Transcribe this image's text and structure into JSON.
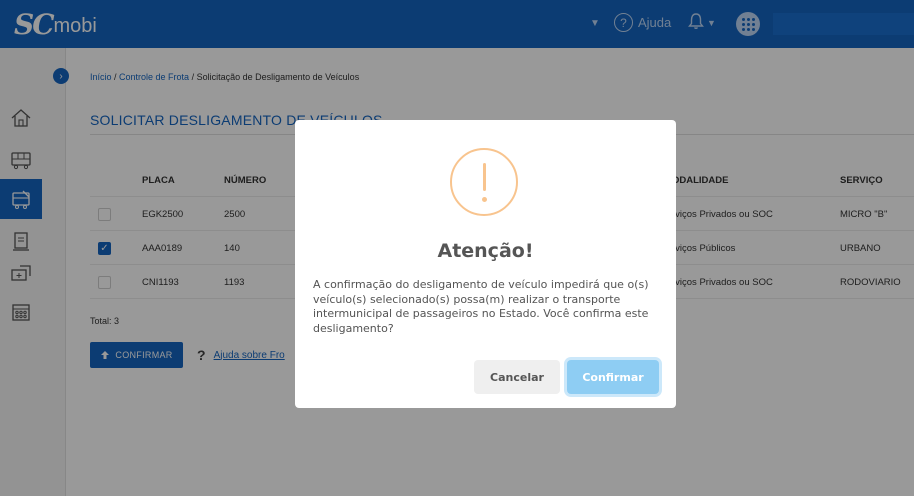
{
  "app": {
    "logo_sc": "SC",
    "logo_mobi": "mobi"
  },
  "topbar": {
    "help_label": "Ajuda",
    "help_glyph": "?",
    "bell_icon": "bell-icon",
    "apps_icon": "apps-grid-icon"
  },
  "breadcrumb": {
    "home": "Início",
    "sep1": " / ",
    "section": "Controle de Frota",
    "sep2": " / ",
    "current": "Solicitação de Desligamento de Veículos"
  },
  "page": {
    "title": "SOLICITAR DESLIGAMENTO DE VEÍCULOS"
  },
  "table": {
    "headers": {
      "placa": "PLACA",
      "numero": "NÚMERO",
      "modalidade": "ODALIDADE",
      "servico": "SERVIÇO"
    },
    "rows": [
      {
        "checked": false,
        "placa": "EGK2500",
        "numero": "2500",
        "modalidade": "rviços Privados ou SOC",
        "servico": "MICRO \"B\""
      },
      {
        "checked": true,
        "placa": "AAA0189",
        "numero": "140",
        "modalidade": "rviços Públicos",
        "servico": "URBANO"
      },
      {
        "checked": false,
        "placa": "CNI1193",
        "numero": "1193",
        "modalidade": "rviços Privados ou SOC",
        "servico": "RODOVIARIO"
      }
    ]
  },
  "footer": {
    "total": "Total: 3",
    "confirm_label": "CONFIRMAR",
    "help_q": "?",
    "help_text": "Ajuda sobre Fro"
  },
  "modal": {
    "title": "Atenção!",
    "message": "A confirmação do desligamento de veículo impedirá que o(s) veículo(s) selecionado(s) possa(m) realizar o transporte intermunicipal de passageiros no Estado. Você confirma este desligamento?",
    "cancel_label": "Cancelar",
    "confirm_label": "Confirmar"
  },
  "colors": {
    "primary": "#1565c0",
    "warning": "#f8c48e",
    "confirm_button": "#8ecdf3"
  }
}
